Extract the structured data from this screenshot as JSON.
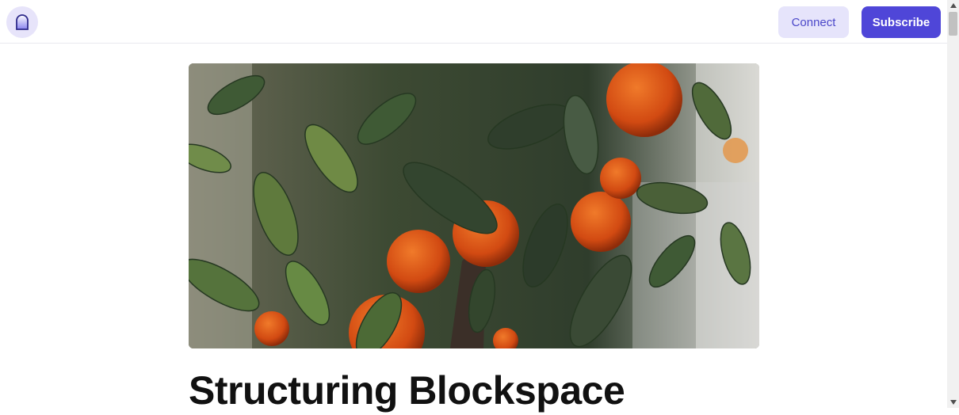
{
  "header": {
    "logo_icon": "arch-door-icon",
    "connect_label": "Connect",
    "subscribe_label": "Subscribe",
    "accent_color": "#4f46d8",
    "accent_light": "#e6e4fb"
  },
  "article": {
    "hero_image": "photo-orange-tree-with-oranges-and-leaves",
    "title": "Structuring Blockspace"
  },
  "scrollbar": {
    "up_icon": "triangle-up-icon",
    "down_icon": "triangle-down-icon"
  }
}
